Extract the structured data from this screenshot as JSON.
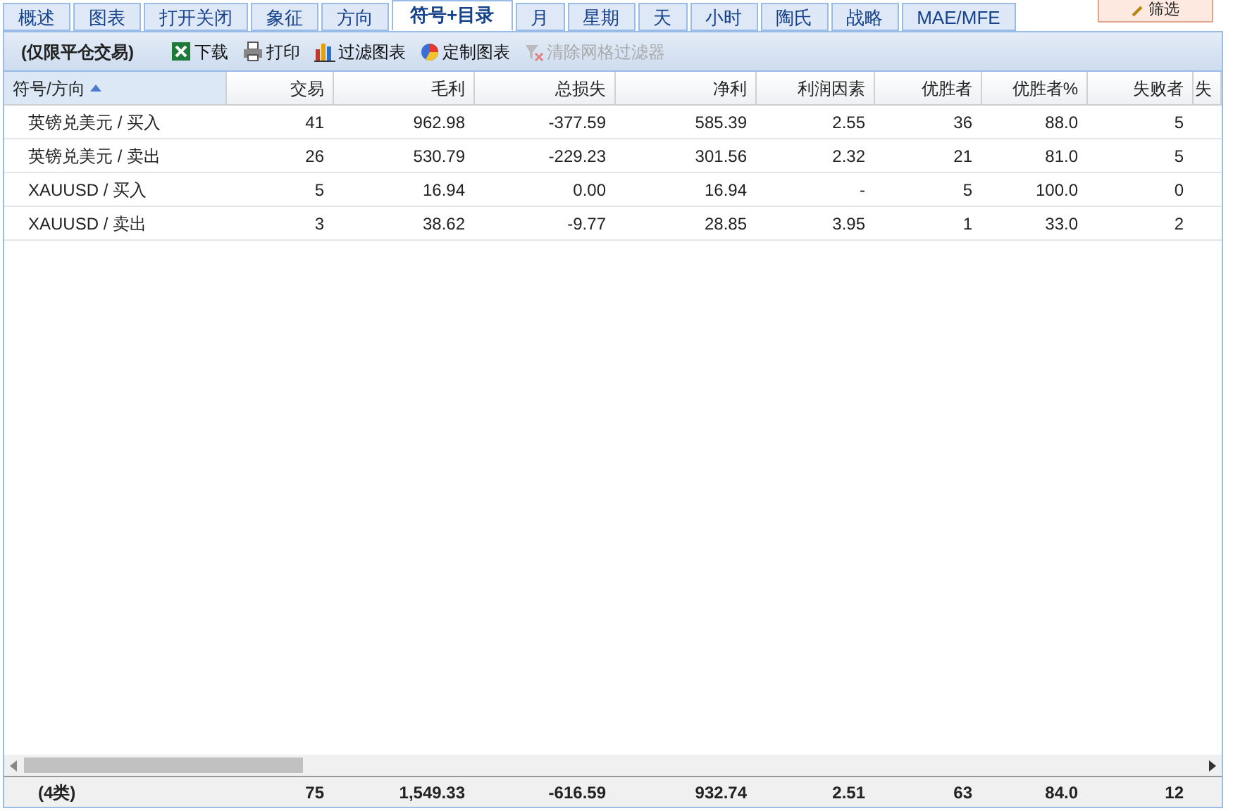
{
  "tabs": [
    {
      "label": "概述",
      "selected": false
    },
    {
      "label": "图表",
      "selected": false
    },
    {
      "label": "打开关闭",
      "selected": false
    },
    {
      "label": "象征",
      "selected": false
    },
    {
      "label": "方向",
      "selected": false
    },
    {
      "label": "符号+目录",
      "selected": true
    },
    {
      "label": "月",
      "selected": false
    },
    {
      "label": "星期",
      "selected": false
    },
    {
      "label": "天",
      "selected": false
    },
    {
      "label": "小时",
      "selected": false
    },
    {
      "label": "陶氏",
      "selected": false
    },
    {
      "label": "战略",
      "selected": false
    },
    {
      "label": "MAE/MFE",
      "selected": false
    }
  ],
  "filter_button": {
    "label": "筛选"
  },
  "toolbar": {
    "title": "(仅限平仓交易)",
    "buttons": [
      {
        "kind": "excel",
        "label": "下载",
        "disabled": false
      },
      {
        "kind": "print",
        "label": "打印",
        "disabled": false
      },
      {
        "kind": "barchart",
        "label": "过滤图表",
        "disabled": false
      },
      {
        "kind": "pie",
        "label": "定制图表",
        "disabled": false
      },
      {
        "kind": "clear",
        "label": "清除网格过滤器",
        "disabled": true
      }
    ]
  },
  "table": {
    "columns": [
      {
        "label": "符号/方向",
        "sorted": true
      },
      {
        "label": "交易",
        "sorted": false
      },
      {
        "label": "毛利",
        "sorted": false
      },
      {
        "label": "总损失",
        "sorted": false
      },
      {
        "label": "净利",
        "sorted": false
      },
      {
        "label": "利润因素",
        "sorted": false
      },
      {
        "label": "优胜者",
        "sorted": false
      },
      {
        "label": "优胜者%",
        "sorted": false
      },
      {
        "label": "失败者",
        "sorted": false
      },
      {
        "label": "失",
        "sorted": false
      }
    ],
    "rows": [
      [
        "英镑兑美元 / 买入",
        "41",
        "962.98",
        "-377.59",
        "585.39",
        "2.55",
        "36",
        "88.0",
        "5"
      ],
      [
        "英镑兑美元 / 卖出",
        "26",
        "530.79",
        "-229.23",
        "301.56",
        "2.32",
        "21",
        "81.0",
        "5"
      ],
      [
        "XAUUSD / 买入",
        "5",
        "16.94",
        "0.00",
        "16.94",
        "-",
        "5",
        "100.0",
        "0"
      ],
      [
        "XAUUSD / 卖出",
        "3",
        "38.62",
        "-9.77",
        "28.85",
        "3.95",
        "1",
        "33.0",
        "2"
      ]
    ],
    "footer": [
      "(4类)",
      "75",
      "1,549.33",
      "-616.59",
      "932.74",
      "2.51",
      "63",
      "84.0",
      "12"
    ]
  }
}
